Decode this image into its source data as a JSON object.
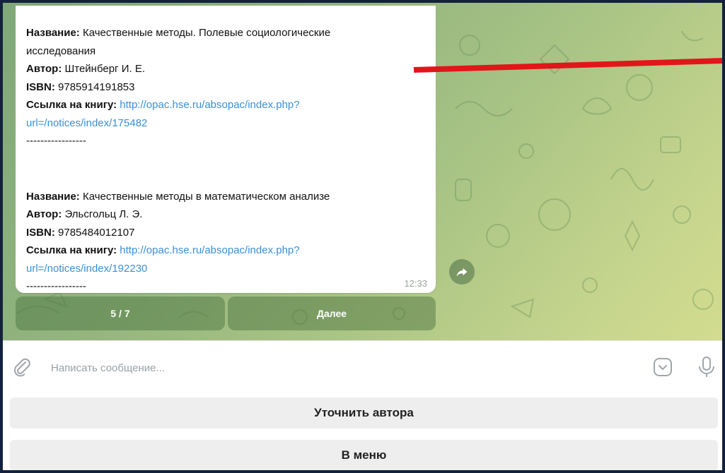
{
  "message": {
    "book1": {
      "title_label": "Название:",
      "title_line1": "Качественные методы. Полевые социологические",
      "title_line2": "исследования",
      "author_label": "Автор:",
      "author": "Штейнберг И. Е.",
      "isbn_label": "ISBN:",
      "isbn": "9785914191853",
      "link_label": "Ссылка на книгу:",
      "link_line1": "http://opac.hse.ru/absopac/index.php?",
      "link_line2": "url=/notices/index/175482",
      "separator": "-----------------"
    },
    "book2": {
      "title_label": "Название:",
      "title": "Качественные методы в математическом анализе",
      "author_label": "Автор:",
      "author": "Эльсгольц Л. Э.",
      "isbn_label": "ISBN:",
      "isbn": "9785484012107",
      "link_label": "Ссылка на книгу:",
      "link_line1": "http://opac.hse.ru/absopac/index.php?",
      "link_line2": "url=/notices/index/192230",
      "separator": "-----------------"
    },
    "time": "12:33"
  },
  "inline_keyboard": {
    "page_indicator": "5 / 7",
    "next_label": "Далее"
  },
  "composer": {
    "placeholder": "Написать сообщение..."
  },
  "reply_keyboard": {
    "refine_author_label": "Уточнить автора",
    "menu_label": "В меню"
  },
  "colors": {
    "link": "#3a8fd6",
    "annotation_arrow": "#e2161a",
    "frame_border": "#14213d"
  },
  "icons": [
    "paperclip-icon",
    "sticker-icon",
    "microphone-icon",
    "share-icon"
  ]
}
